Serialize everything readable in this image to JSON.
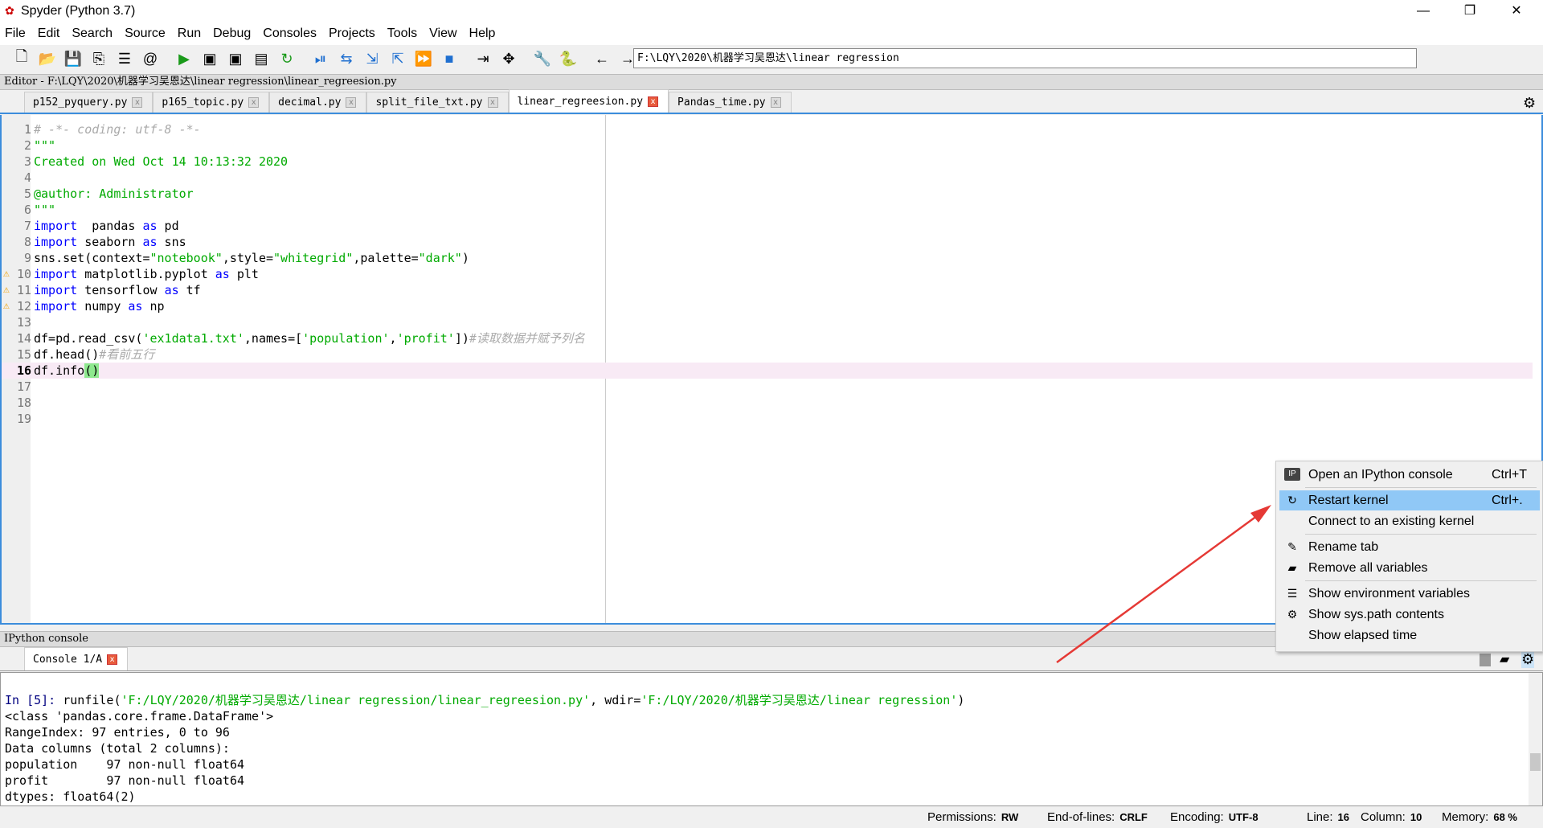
{
  "window": {
    "title": "Spyder (Python 3.7)",
    "minimize": "—",
    "restore": "❐",
    "close": "✕"
  },
  "menu": [
    "File",
    "Edit",
    "Search",
    "Source",
    "Run",
    "Debug",
    "Consoles",
    "Projects",
    "Tools",
    "View",
    "Help"
  ],
  "toolbar": {
    "path": "F:\\LQY\\2020\\机器学习吴恩达\\linear regression",
    "icons": [
      "new-file",
      "open-file",
      "save",
      "save-all",
      "outline",
      "at",
      "run",
      "run-cell",
      "run-cell-advance",
      "run-selection",
      "rerun",
      "debug",
      "step",
      "step-into",
      "step-return",
      "continue",
      "stop",
      "maximize",
      "fullscreen",
      "preferences",
      "python-path",
      "back",
      "forward"
    ]
  },
  "editor": {
    "header": "Editor - F:\\LQY\\2020\\机器学习吴恩达\\linear regression\\linear_regreesion.py",
    "tabs": [
      {
        "label": "p152_pyquery.py"
      },
      {
        "label": "p165_topic.py"
      },
      {
        "label": "decimal.py"
      },
      {
        "label": "split_file_txt.py"
      },
      {
        "label": "linear_regreesion.py",
        "active": true
      },
      {
        "label": "Pandas_time.py"
      }
    ],
    "current_line": 16,
    "lines": [
      {
        "n": "1",
        "parts": [
          [
            "cm",
            "# -*- coding: utf-8 -*-"
          ]
        ]
      },
      {
        "n": "2",
        "parts": [
          [
            "st",
            "\"\"\""
          ]
        ]
      },
      {
        "n": "3",
        "parts": [
          [
            "st",
            "Created on Wed Oct 14 10:13:32 2020"
          ]
        ]
      },
      {
        "n": "4",
        "parts": []
      },
      {
        "n": "5",
        "parts": [
          [
            "st",
            "@author: Administrator"
          ]
        ]
      },
      {
        "n": "6",
        "parts": [
          [
            "st",
            "\"\"\""
          ]
        ]
      },
      {
        "n": "7",
        "parts": [
          [
            "kw",
            "import"
          ],
          [
            "",
            "  pandas "
          ],
          [
            "kw",
            "as"
          ],
          [
            "",
            " pd"
          ]
        ]
      },
      {
        "n": "8",
        "parts": [
          [
            "kw",
            "import"
          ],
          [
            "",
            " seaborn "
          ],
          [
            "kw",
            "as"
          ],
          [
            "",
            " sns"
          ]
        ]
      },
      {
        "n": "9",
        "parts": [
          [
            "",
            "sns.set(context="
          ],
          [
            "st",
            "\"notebook\""
          ],
          [
            "",
            ",style="
          ],
          [
            "st",
            "\"whitegrid\""
          ],
          [
            "",
            ",palette="
          ],
          [
            "st",
            "\"dark\""
          ],
          [
            "",
            ")"
          ]
        ]
      },
      {
        "n": "10",
        "warn": true,
        "parts": [
          [
            "kw",
            "import"
          ],
          [
            "",
            " matplotlib.pyplot "
          ],
          [
            "kw",
            "as"
          ],
          [
            "",
            " plt"
          ]
        ]
      },
      {
        "n": "11",
        "warn": true,
        "parts": [
          [
            "kw",
            "import"
          ],
          [
            "",
            " tensorflow "
          ],
          [
            "kw",
            "as"
          ],
          [
            "",
            " tf"
          ]
        ]
      },
      {
        "n": "12",
        "warn": true,
        "parts": [
          [
            "kw",
            "import"
          ],
          [
            "",
            " numpy "
          ],
          [
            "kw",
            "as"
          ],
          [
            "",
            " np"
          ]
        ]
      },
      {
        "n": "13",
        "parts": []
      },
      {
        "n": "14",
        "parts": [
          [
            "",
            "df=pd.read_csv("
          ],
          [
            "st",
            "'ex1data1.txt'"
          ],
          [
            "",
            ",names=["
          ],
          [
            "st",
            "'population'"
          ],
          [
            "",
            ","
          ],
          [
            "st",
            "'profit'"
          ],
          [
            "",
            "])"
          ],
          [
            "cm",
            "#读取数据并赋予列名"
          ]
        ]
      },
      {
        "n": "15",
        "parts": [
          [
            "",
            "df.head()"
          ],
          [
            "cm",
            "#看前五行"
          ]
        ]
      },
      {
        "n": "16",
        "parts": [
          [
            "",
            "df.info"
          ],
          [
            "hlp",
            "()"
          ]
        ]
      },
      {
        "n": "17",
        "parts": []
      },
      {
        "n": "18",
        "parts": []
      },
      {
        "n": "19",
        "parts": []
      }
    ]
  },
  "console": {
    "header": "IPython console",
    "tab": "Console 1/A",
    "prompt": "In [5]: ",
    "cmd_pre": "runfile(",
    "arg1": "'F:/LQY/2020/机器学习吴恩达/linear regression/linear_regreesion.py'",
    "mid": ", wdir=",
    "arg2": "'F:/LQY/2020/机器学习吴恩达/linear regression'",
    "cmd_post": ")",
    "output": [
      "<class 'pandas.core.frame.DataFrame'>",
      "RangeIndex: 97 entries, 0 to 96",
      "Data columns (total 2 columns):",
      "population    97 non-null float64",
      "profit        97 non-null float64",
      "dtypes: float64(2)"
    ]
  },
  "context_menu": [
    {
      "icon": "ipython-icon",
      "glyph": "IP",
      "label": "Open an IPython console",
      "shortcut": "Ctrl+T"
    },
    {
      "sep": true
    },
    {
      "icon": "restart-icon",
      "glyph": "↻",
      "label": "Restart kernel",
      "shortcut": "Ctrl+.",
      "highlighted": true
    },
    {
      "label": "Connect to an existing kernel"
    },
    {
      "sep": true
    },
    {
      "icon": "pencil-icon",
      "glyph": "✎",
      "label": "Rename tab"
    },
    {
      "icon": "eraser-icon",
      "glyph": "▰",
      "label": "Remove all variables"
    },
    {
      "sep": true
    },
    {
      "icon": "list-icon",
      "glyph": "☰",
      "label": "Show environment variables"
    },
    {
      "icon": "gears-icon",
      "glyph": "⚙",
      "label": "Show sys.path contents"
    },
    {
      "label": "Show elapsed time"
    }
  ],
  "status": {
    "permissions_label": "Permissions:",
    "permissions": "RW",
    "eol_label": "End-of-lines:",
    "eol": "CRLF",
    "encoding_label": "Encoding:",
    "encoding": "UTF-8",
    "line_label": "Line:",
    "line": "16",
    "column_label": "Column:",
    "column": "10",
    "memory_label": "Memory:",
    "memory": "68 %"
  },
  "colors": {
    "accent": "#3c8ddc",
    "highlight": "#90c8f6",
    "keyword": "#0000ff",
    "string": "#00aa00",
    "arrow": "#e53935"
  }
}
